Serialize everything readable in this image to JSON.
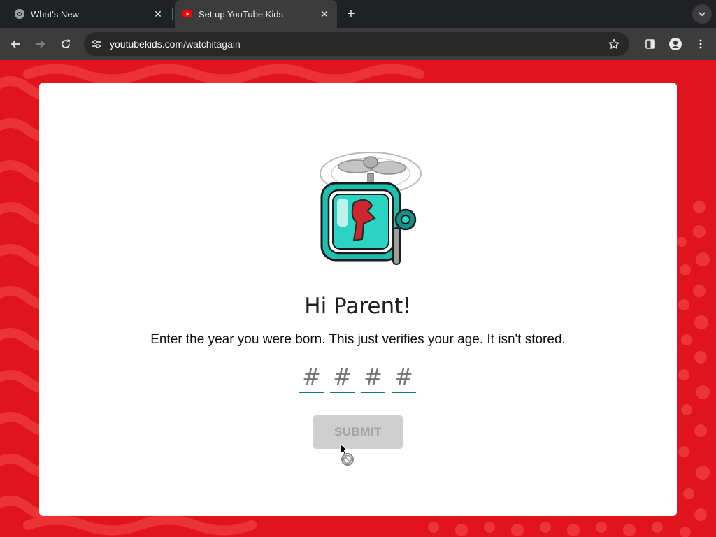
{
  "browser": {
    "tabs": [
      {
        "title": "What's New",
        "icon": "chrome-icon",
        "active": false
      },
      {
        "title": "Set up YouTube Kids",
        "icon": "youtube-icon",
        "active": true
      }
    ],
    "new_tab_label": "+",
    "address": {
      "host": "youtubekids.com",
      "path": "/watchitagain"
    }
  },
  "page": {
    "background_color": "#e1141e",
    "greeting": "Hi Parent!",
    "instruction": "Enter the year you were born. This just verifies your age. It isn't stored.",
    "year_digits": [
      {
        "placeholder": "#",
        "value": ""
      },
      {
        "placeholder": "#",
        "value": ""
      },
      {
        "placeholder": "#",
        "value": ""
      },
      {
        "placeholder": "#",
        "value": ""
      }
    ],
    "submit_label": "SUBMIT",
    "submit_enabled": false,
    "accent_color": "#0f7a8a"
  }
}
